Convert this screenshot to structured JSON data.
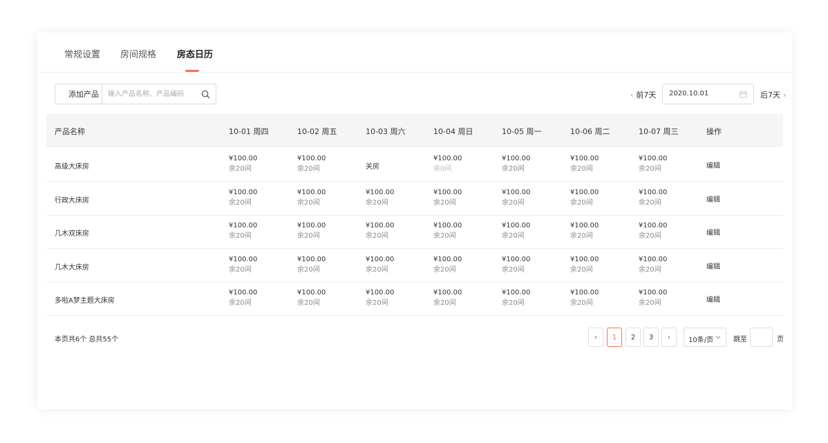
{
  "tabs": [
    {
      "label": "常规设置"
    },
    {
      "label": "房间规格"
    },
    {
      "label": "房态日历"
    }
  ],
  "active_tab_index": 2,
  "toolbar": {
    "add_product_label": "添加产品",
    "search_placeholder": "输入产品名称、产品编码",
    "prev_week_label": "前7天",
    "date_value": "2020.10.01",
    "next_week_label": "后7天"
  },
  "table": {
    "headers": [
      "产品名称",
      "10-01 周四",
      "10-02 周五",
      "10-03 周六",
      "10-04 周日",
      "10-05 周一",
      "10-06 周二",
      "10-07 周三",
      "操作"
    ],
    "action_label": "编辑",
    "closed_label": "关房",
    "rows": [
      {
        "name": "高级大床房",
        "cells": [
          {
            "price": "¥100.00",
            "remain": "余20间"
          },
          {
            "price": "¥100.00",
            "remain": "余20间"
          },
          {
            "closed": true
          },
          {
            "price": "¥100.00",
            "remain": "余0间",
            "zero": true
          },
          {
            "price": "¥100.00",
            "remain": "余20间"
          },
          {
            "price": "¥100.00",
            "remain": "余20间"
          },
          {
            "price": "¥100.00",
            "remain": "余20间"
          }
        ]
      },
      {
        "name": "行政大床房",
        "cells": [
          {
            "price": "¥100.00",
            "remain": "余20间"
          },
          {
            "price": "¥100.00",
            "remain": "余20间"
          },
          {
            "price": "¥100.00",
            "remain": "余20间"
          },
          {
            "price": "¥100.00",
            "remain": "余20间"
          },
          {
            "price": "¥100.00",
            "remain": "余20间"
          },
          {
            "price": "¥100.00",
            "remain": "余20间"
          },
          {
            "price": "¥100.00",
            "remain": "余20间"
          }
        ]
      },
      {
        "name": "几木双床房",
        "cells": [
          {
            "price": "¥100.00",
            "remain": "余20间"
          },
          {
            "price": "¥100.00",
            "remain": "余20间"
          },
          {
            "price": "¥100.00",
            "remain": "余20间"
          },
          {
            "price": "¥100.00",
            "remain": "余20间"
          },
          {
            "price": "¥100.00",
            "remain": "余20间"
          },
          {
            "price": "¥100.00",
            "remain": "余20间"
          },
          {
            "price": "¥100.00",
            "remain": "余20间"
          }
        ]
      },
      {
        "name": "几木大床房",
        "cells": [
          {
            "price": "¥100.00",
            "remain": "余20间"
          },
          {
            "price": "¥100.00",
            "remain": "余20间"
          },
          {
            "price": "¥100.00",
            "remain": "余20间"
          },
          {
            "price": "¥100.00",
            "remain": "余20间"
          },
          {
            "price": "¥100.00",
            "remain": "余20间"
          },
          {
            "price": "¥100.00",
            "remain": "余20间"
          },
          {
            "price": "¥100.00",
            "remain": "余20间"
          }
        ]
      },
      {
        "name": "多啦A梦主题大床房",
        "cells": [
          {
            "price": "¥100.00",
            "remain": "余20间"
          },
          {
            "price": "¥100.00",
            "remain": "余20间"
          },
          {
            "price": "¥100.00",
            "remain": "余20间"
          },
          {
            "price": "¥100.00",
            "remain": "余20间"
          },
          {
            "price": "¥100.00",
            "remain": "余20间"
          },
          {
            "price": "¥100.00",
            "remain": "余20间"
          },
          {
            "price": "¥100.00",
            "remain": "余20间"
          }
        ]
      }
    ]
  },
  "footer": {
    "summary": "本页共6个 总共55个",
    "pages": [
      "1",
      "2",
      "3"
    ],
    "current_page": "1",
    "page_size": "10条/页",
    "jump_label": "跳至",
    "jump_suffix": "页"
  },
  "colors": {
    "accent": "#f0744b",
    "header_bg": "#f5f5f5",
    "border": "#d9d9d9"
  },
  "icons": {
    "search": "search-icon",
    "calendar": "calendar-icon",
    "prev": "chevron-left-icon",
    "next": "chevron-right-icon",
    "dropdown": "chevron-down-icon"
  }
}
